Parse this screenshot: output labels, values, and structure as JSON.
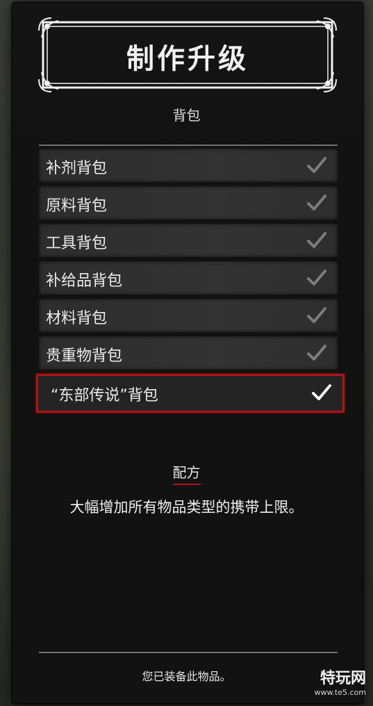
{
  "header": {
    "title": "制作升级",
    "category": "背包"
  },
  "items": [
    {
      "label": "补剂背包",
      "checked": true,
      "selected": false
    },
    {
      "label": "原料背包",
      "checked": true,
      "selected": false
    },
    {
      "label": "工具背包",
      "checked": true,
      "selected": false
    },
    {
      "label": "补给品背包",
      "checked": true,
      "selected": false
    },
    {
      "label": "材料背包",
      "checked": true,
      "selected": false
    },
    {
      "label": "贵重物背包",
      "checked": true,
      "selected": false
    },
    {
      "label": "“东部传说”背包",
      "checked": true,
      "selected": true
    }
  ],
  "recipe": {
    "heading": "配方",
    "description": "大幅增加所有物品类型的携带上限。"
  },
  "footer": {
    "status": "您已装备此物品。"
  },
  "watermark": {
    "text": "特玩网",
    "url": "www.te5.com"
  },
  "colors": {
    "accent_red": "#b01419",
    "check_dim": "#7d7d7d",
    "check_bright": "#ffffff"
  },
  "icons": {
    "check": "check-icon"
  }
}
